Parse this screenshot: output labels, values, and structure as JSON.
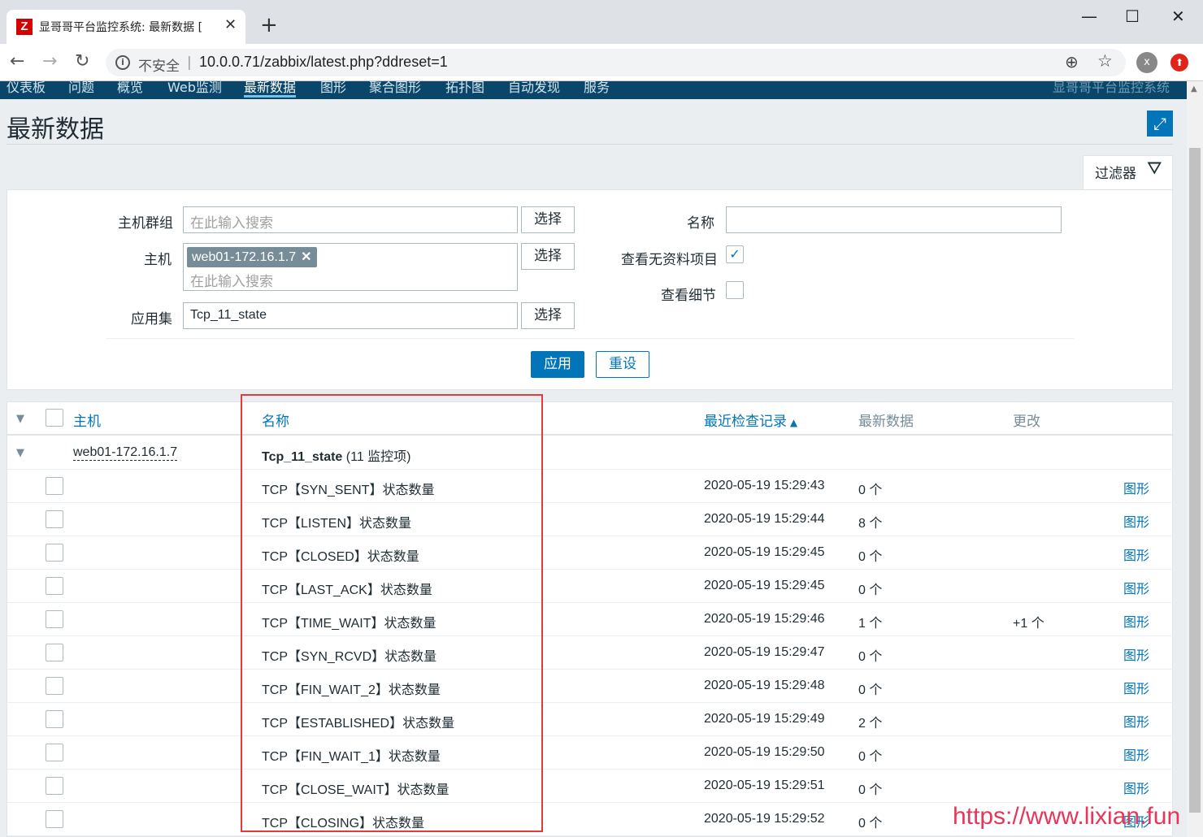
{
  "browser": {
    "tab_title": "显哥哥平台监控系统: 最新数据 [",
    "tab_favicon": "Z",
    "new_tab": "+",
    "security_label": "不安全",
    "url": "10.0.0.71/zabbix/latest.php?ddreset=1",
    "profile_initial": "x"
  },
  "nav": {
    "items": [
      "仪表板",
      "问题",
      "概览",
      "Web监测",
      "最新数据",
      "图形",
      "聚合图形",
      "拓扑图",
      "自动发现",
      "服务"
    ],
    "active": "最新数据",
    "brand": "显哥哥平台监控系统"
  },
  "page": {
    "title": "最新数据",
    "filter_tab": "过滤器"
  },
  "filter": {
    "host_group_label": "主机群组",
    "host_group_placeholder": "在此输入搜索",
    "host_label": "主机",
    "host_tag": "web01-172.16.1.7",
    "host_placeholder": "在此输入搜索",
    "application_label": "应用集",
    "application_value": "Tcp_11_state",
    "select_label": "选择",
    "name_label": "名称",
    "name_value": "",
    "show_no_data_label": "查看无资料项目",
    "show_no_data_checked": true,
    "show_details_label": "查看细节",
    "show_details_checked": false,
    "apply_label": "应用",
    "reset_label": "重设"
  },
  "table": {
    "headers": {
      "host": "主机",
      "name": "名称",
      "last_check": "最近检查记录",
      "last_value": "最新数据",
      "change": "更改"
    },
    "group": {
      "host": "web01-172.16.1.7",
      "app": "Tcp_11_state",
      "count": "(11 监控项)"
    },
    "graph_label": "图形",
    "rows": [
      {
        "name": "TCP【SYN_SENT】状态数量",
        "time": "2020-05-19 15:29:43",
        "value": "0 个",
        "change": ""
      },
      {
        "name": "TCP【LISTEN】状态数量",
        "time": "2020-05-19 15:29:44",
        "value": "8 个",
        "change": ""
      },
      {
        "name": "TCP【CLOSED】状态数量",
        "time": "2020-05-19 15:29:45",
        "value": "0 个",
        "change": ""
      },
      {
        "name": "TCP【LAST_ACK】状态数量",
        "time": "2020-05-19 15:29:45",
        "value": "0 个",
        "change": ""
      },
      {
        "name": "TCP【TIME_WAIT】状态数量",
        "time": "2020-05-19 15:29:46",
        "value": "1 个",
        "change": "+1 个"
      },
      {
        "name": "TCP【SYN_RCVD】状态数量",
        "time": "2020-05-19 15:29:47",
        "value": "0 个",
        "change": ""
      },
      {
        "name": "TCP【FIN_WAIT_2】状态数量",
        "time": "2020-05-19 15:29:48",
        "value": "0 个",
        "change": ""
      },
      {
        "name": "TCP【ESTABLISHED】状态数量",
        "time": "2020-05-19 15:29:49",
        "value": "2 个",
        "change": ""
      },
      {
        "name": "TCP【FIN_WAIT_1】状态数量",
        "time": "2020-05-19 15:29:50",
        "value": "0 个",
        "change": ""
      },
      {
        "name": "TCP【CLOSE_WAIT】状态数量",
        "time": "2020-05-19 15:29:51",
        "value": "0 个",
        "change": ""
      },
      {
        "name": "TCP【CLOSING】状态数量",
        "time": "2020-05-19 15:29:52",
        "value": "0 个",
        "change": ""
      }
    ]
  },
  "watermark": "https://www.lixian.fun",
  "colors": {
    "nav_bg": "#0a466a",
    "link": "#0275b8",
    "highlight": "#e03c3c",
    "watermark": "#e8355a"
  }
}
